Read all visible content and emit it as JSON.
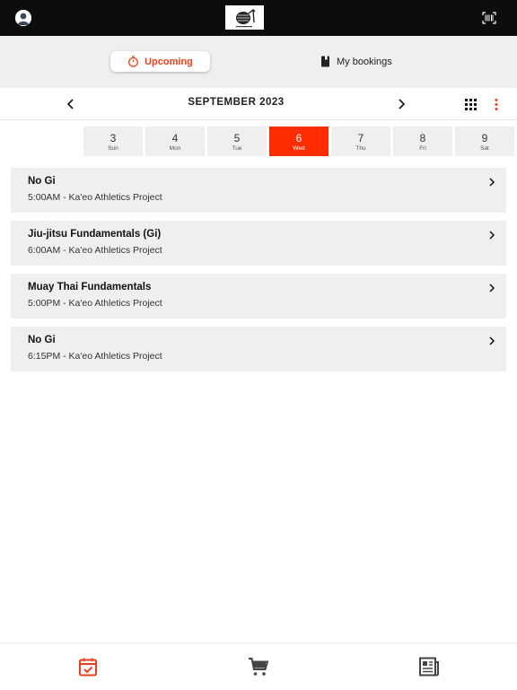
{
  "header": {
    "avatar_icon": "user-avatar-icon",
    "logo_icon": "gym-logo",
    "barcode_icon": "barcode-scan-icon"
  },
  "segments": {
    "upcoming_label": "Upcoming",
    "upcoming_icon": "stopwatch-icon",
    "bookings_label": "My bookings",
    "bookings_icon": "bookmark-icon",
    "accent_color": "#e8401c"
  },
  "calendar": {
    "month_label": "SEPTEMBER 2023",
    "prev_icon": "chevron-left-icon",
    "next_icon": "chevron-right-icon",
    "grid_icon": "grid-view-icon",
    "more_icon": "more-vertical-icon",
    "days": [
      {
        "num": "3",
        "dow": "Sun"
      },
      {
        "num": "4",
        "dow": "Mon"
      },
      {
        "num": "5",
        "dow": "Tue"
      },
      {
        "num": "6",
        "dow": "Wed",
        "selected": true
      },
      {
        "num": "7",
        "dow": "Thu"
      },
      {
        "num": "8",
        "dow": "Fri"
      },
      {
        "num": "9",
        "dow": "Sat"
      }
    ],
    "selected_color": "#ff2d00"
  },
  "classes": [
    {
      "title": "No Gi",
      "subtitle": "5:00AM - Ka'eo Athletics Project"
    },
    {
      "title": "Jiu-jitsu Fundamentals (Gi)",
      "subtitle": "6:00AM - Ka'eo Athletics Project"
    },
    {
      "title": "Muay Thai Fundamentals",
      "subtitle": "5:00PM - Ka'eo Athletics Project"
    },
    {
      "title": "No Gi",
      "subtitle": "6:15PM - Ka'eo Athletics Project"
    }
  ],
  "bottom_nav": [
    {
      "icon": "calendar-check-icon",
      "active": true
    },
    {
      "icon": "shopping-cart-icon",
      "active": false
    },
    {
      "icon": "newspaper-icon",
      "active": false
    }
  ]
}
